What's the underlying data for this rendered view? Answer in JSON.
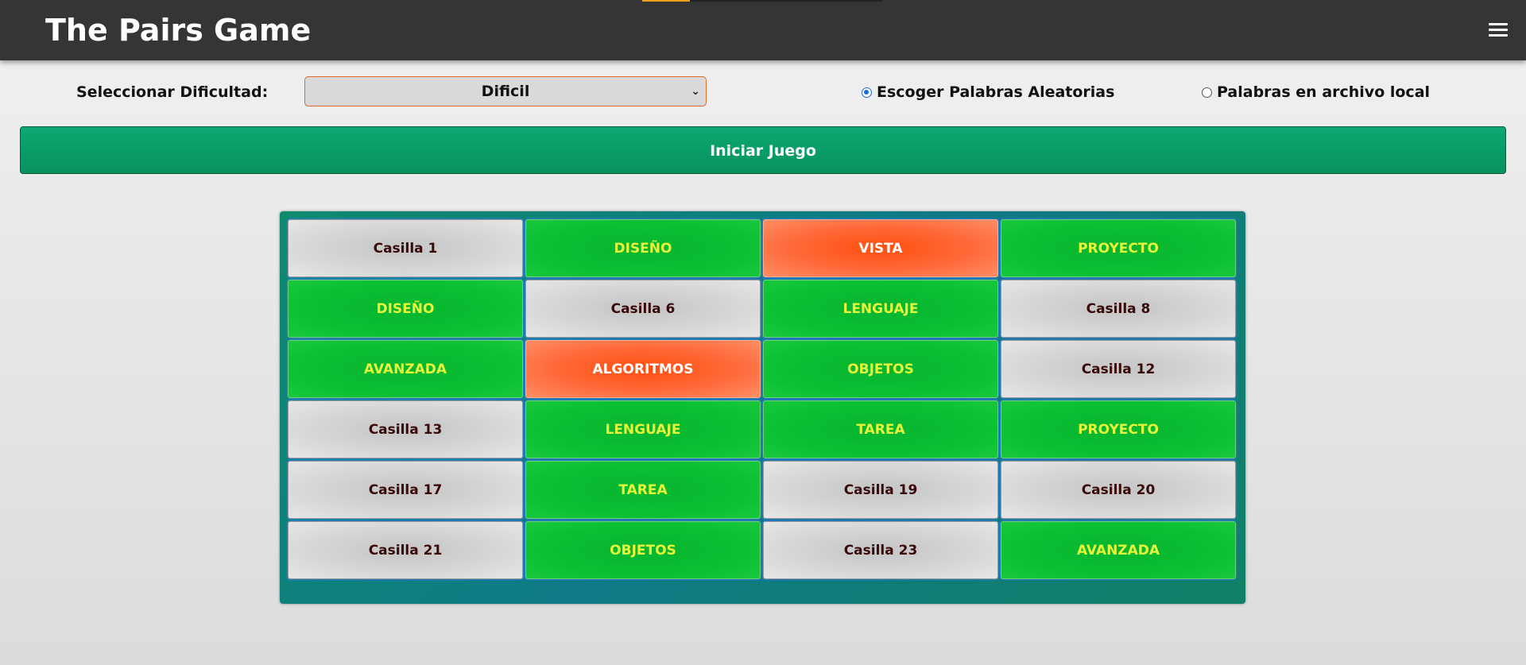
{
  "header": {
    "title": "The Pairs Game",
    "menu_icon": "hamburger-menu-icon",
    "progress": 0.2
  },
  "controls": {
    "difficulty_label": "Seleccionar Dificultad:",
    "difficulty_value": "Dificil",
    "difficulty_caret": "⌄",
    "radio_random": "Escoger Palabras Aleatorias",
    "radio_local": "Palabras en archivo local",
    "radio_selected": "random"
  },
  "start_button": "Iniciar Juego",
  "colors": {
    "header_bg": "#353535",
    "start_button": "#0a9e68",
    "board": "#0e7a86",
    "matched_tile": "#0bbf32",
    "matched_text": "#e6f53a",
    "selected_tile": "#ff6a3a",
    "hidden_tile": "#d6d6d6",
    "hidden_text": "#3a0a0a"
  },
  "board": {
    "columns": 4,
    "rows": 6,
    "tiles": [
      {
        "label": "Casilla 1",
        "state": "hidden"
      },
      {
        "label": "DISEÑO",
        "state": "matched"
      },
      {
        "label": "VISTA",
        "state": "selected"
      },
      {
        "label": "PROYECTO",
        "state": "matched"
      },
      {
        "label": "DISEÑO",
        "state": "matched"
      },
      {
        "label": "Casilla 6",
        "state": "hidden"
      },
      {
        "label": "LENGUAJE",
        "state": "matched"
      },
      {
        "label": "Casilla 8",
        "state": "hidden"
      },
      {
        "label": "AVANZADA",
        "state": "matched"
      },
      {
        "label": "ALGORITMOS",
        "state": "selected"
      },
      {
        "label": "OBJETOS",
        "state": "matched"
      },
      {
        "label": "Casilla 12",
        "state": "hidden"
      },
      {
        "label": "Casilla 13",
        "state": "hidden"
      },
      {
        "label": "LENGUAJE",
        "state": "matched"
      },
      {
        "label": "TAREA",
        "state": "matched"
      },
      {
        "label": "PROYECTO",
        "state": "matched"
      },
      {
        "label": "Casilla 17",
        "state": "hidden"
      },
      {
        "label": "TAREA",
        "state": "matched"
      },
      {
        "label": "Casilla 19",
        "state": "hidden"
      },
      {
        "label": "Casilla 20",
        "state": "hidden"
      },
      {
        "label": "Casilla 21",
        "state": "hidden"
      },
      {
        "label": "OBJETOS",
        "state": "matched"
      },
      {
        "label": "Casilla 23",
        "state": "hidden"
      },
      {
        "label": "AVANZADA",
        "state": "matched"
      }
    ]
  }
}
